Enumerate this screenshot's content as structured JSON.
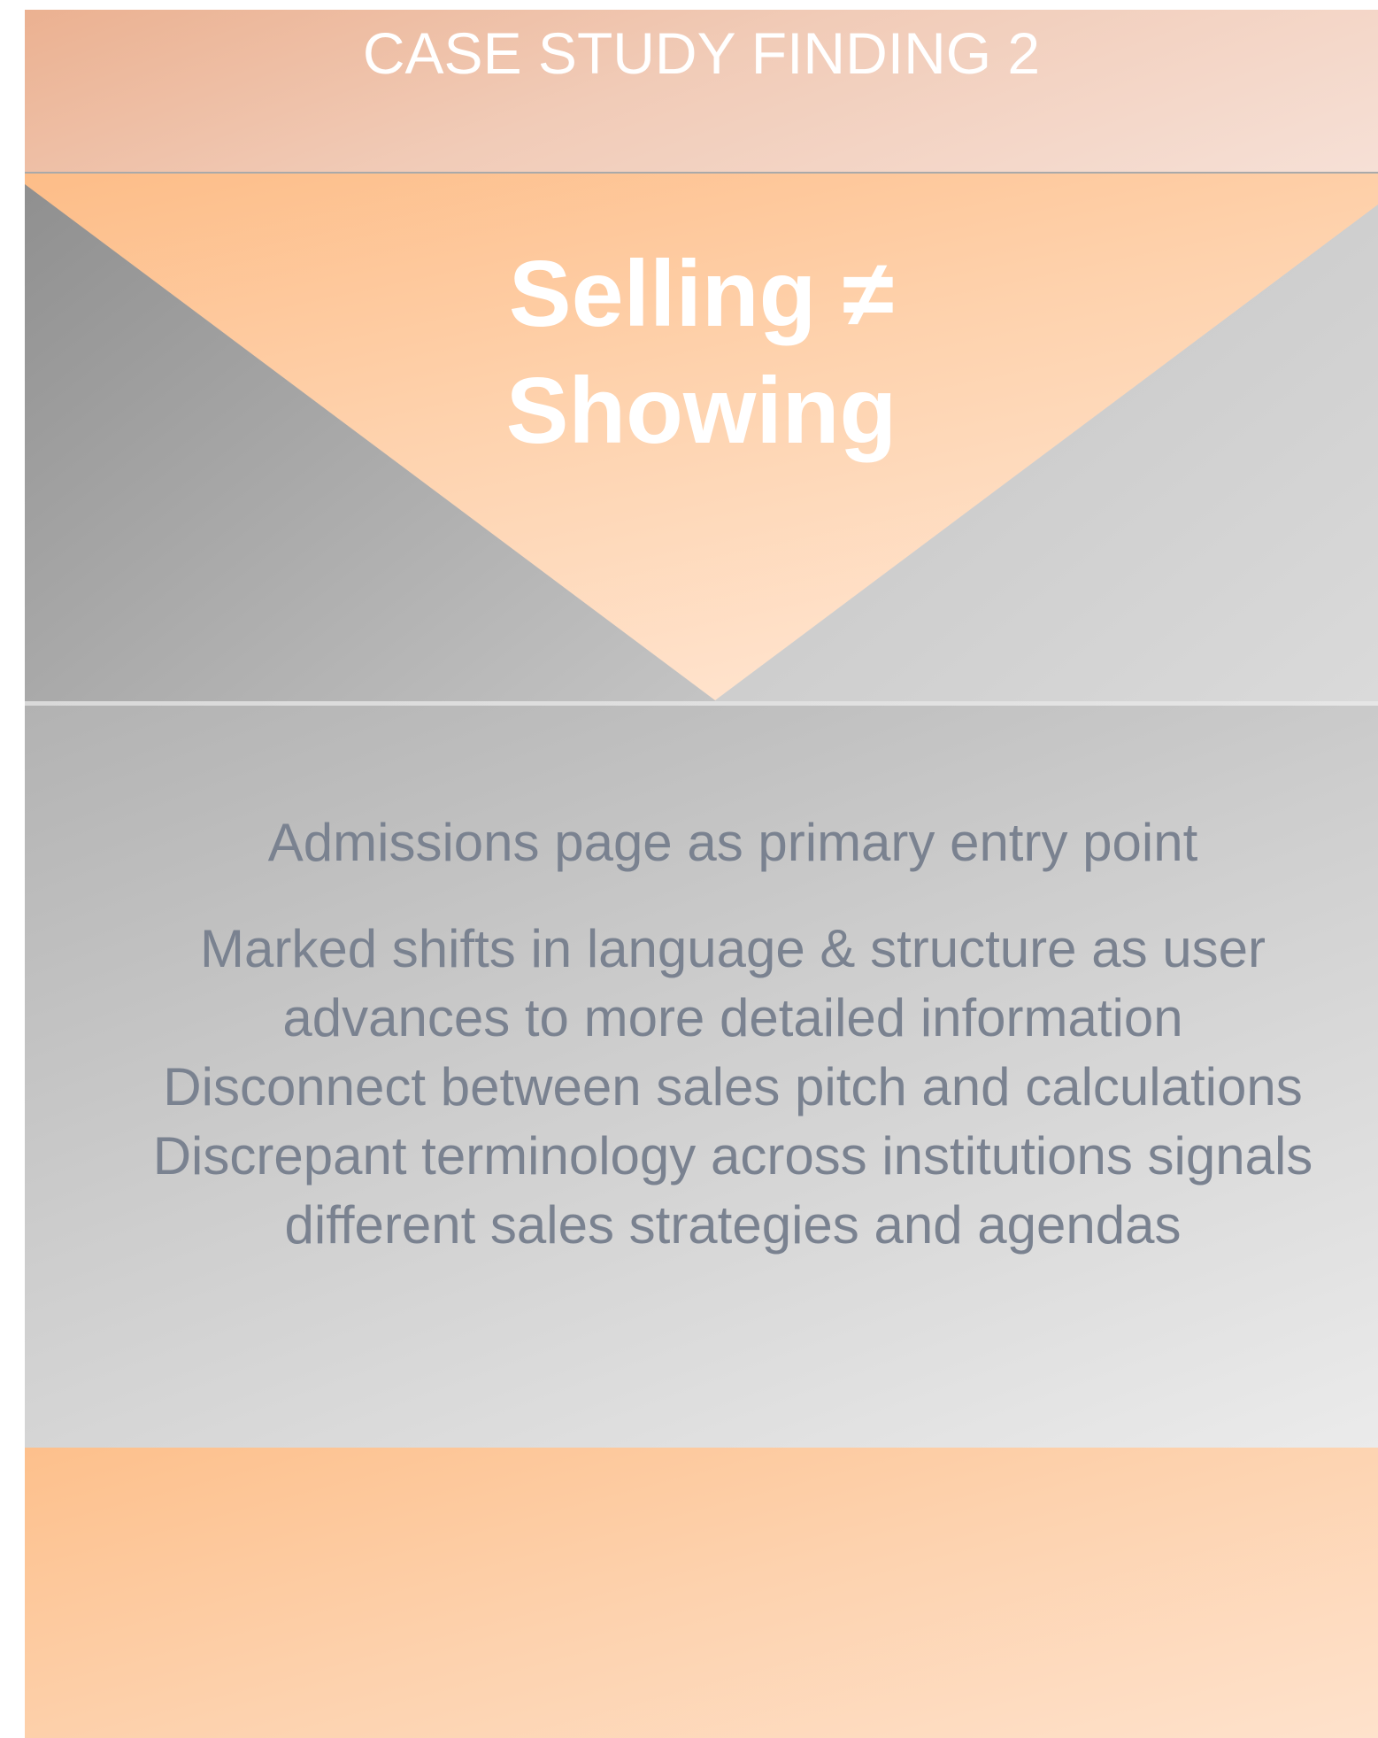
{
  "header": {
    "title": "CASE STUDY FINDING 2"
  },
  "hero": {
    "title_line1": "Selling ≠",
    "title_line2": "Showing"
  },
  "findings": [
    "Admissions page as primary entry point",
    "Marked shifts in language & structure as user advances to more detailed information",
    "Disconnect between sales pitch and calculations",
    "Discrepant terminology across institutions signals different sales strategies and agendas"
  ],
  "colors": {
    "accent_orange": "#fdbf8a",
    "header_peach": "#ebb191",
    "gray_dark": "#8e8e8e",
    "gray_light": "#d6d6d6",
    "body_text": "#7a8290",
    "title_text": "#ffffff"
  }
}
